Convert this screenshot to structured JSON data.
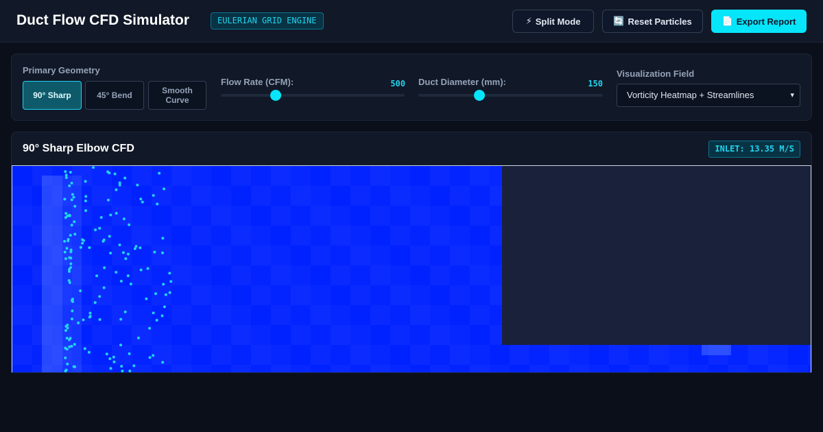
{
  "header": {
    "title": "Duct Flow CFD Simulator",
    "engine_badge": "EULERIAN GRID ENGINE",
    "buttons": {
      "split": {
        "icon": "lightning-icon",
        "glyph": "⚡",
        "label": "Split Mode"
      },
      "reset": {
        "icon": "refresh-icon",
        "glyph": "🔄",
        "label": "Reset Particles"
      },
      "export": {
        "icon": "document-icon",
        "glyph": "📄",
        "label": "Export Report"
      }
    }
  },
  "controls": {
    "geometry_label": "Primary Geometry",
    "geometry_options": [
      {
        "label": "90° Sharp",
        "selected": true
      },
      {
        "label": "45° Bend",
        "selected": false
      },
      {
        "label": "Smooth Curve",
        "selected": false
      }
    ],
    "flow_rate": {
      "label": "Flow Rate (CFM):",
      "value": "500",
      "fraction": 0.3
    },
    "duct_diameter": {
      "label": "Duct Diameter (mm):",
      "value": "150",
      "fraction": 0.33
    },
    "visualization": {
      "label": "Visualization Field",
      "selected": "Vorticity Heatmap + Streamlines"
    }
  },
  "panel": {
    "title": "90° Sharp Elbow CFD",
    "inlet_badge": "INLET: 13.35 M/S"
  },
  "colors": {
    "accent": "#06e5f9",
    "flow_field": "#0022ff",
    "particle": "#22d3ee",
    "duct_wall": "#19223a"
  }
}
